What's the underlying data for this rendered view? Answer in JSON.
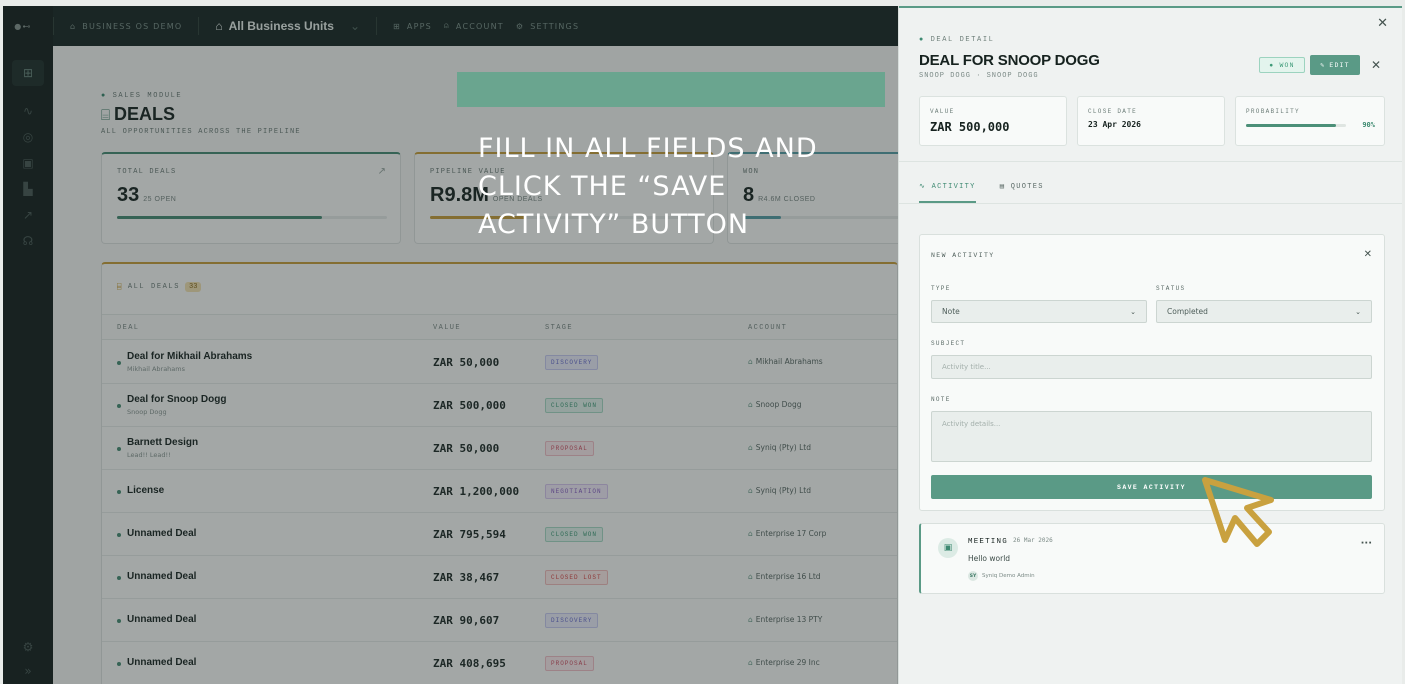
{
  "topbar": {
    "logo": "●⊷",
    "workspace": "BUSINESS OS DEMO",
    "business_unit": "All Business Units",
    "nav": [
      "APPS",
      "ACCOUNT",
      "SETTINGS"
    ]
  },
  "module": {
    "tag": "SALES MODULE",
    "title": "DEALS",
    "subtitle": "ALL OPPORTUNITIES ACROSS THE PIPELINE"
  },
  "stats": {
    "total": {
      "label": "TOTAL DEALS",
      "value": "33",
      "note": "25 OPEN",
      "progress": 0.76
    },
    "pipeline": {
      "label": "PIPELINE VALUE",
      "value": "R9.8M",
      "note": "OPEN DEALS",
      "progress": 0.35
    },
    "won": {
      "label": "WON",
      "value": "8",
      "note": "R4.6M CLOSED",
      "progress": 0.24
    }
  },
  "table": {
    "title": "ALL DEALS",
    "count": "33",
    "columns": [
      "DEAL",
      "VALUE",
      "STAGE",
      "ACCOUNT"
    ],
    "rows": [
      {
        "name": "Deal for Mikhail Abrahams",
        "sub": "Mikhail Abrahams",
        "value": "ZAR 50,000",
        "stage": "DISCOVERY",
        "account": "Mikhail Abrahams"
      },
      {
        "name": "Deal for Snoop Dogg",
        "sub": "Snoop Dogg",
        "value": "ZAR 500,000",
        "stage": "CLOSED WON",
        "account": "Snoop Dogg"
      },
      {
        "name": "Barnett Design",
        "sub": "Lead!! Lead!!",
        "value": "ZAR 50,000",
        "stage": "PROPOSAL",
        "account": "Syniq (Pty) Ltd"
      },
      {
        "name": "License",
        "sub": "",
        "value": "ZAR 1,200,000",
        "stage": "NEGOTIATION",
        "account": "Syniq (Pty) Ltd"
      },
      {
        "name": "Unnamed Deal",
        "sub": "",
        "value": "ZAR 795,594",
        "stage": "CLOSED WON",
        "account": "Enterprise 17 Corp"
      },
      {
        "name": "Unnamed Deal",
        "sub": "",
        "value": "ZAR 38,467",
        "stage": "CLOSED LOST",
        "account": "Enterprise 16 Ltd"
      },
      {
        "name": "Unnamed Deal",
        "sub": "",
        "value": "ZAR 90,607",
        "stage": "DISCOVERY",
        "account": "Enterprise 13 PTY"
      },
      {
        "name": "Unnamed Deal",
        "sub": "",
        "value": "ZAR 408,695",
        "stage": "PROPOSAL",
        "account": "Enterprise 29 Inc"
      }
    ]
  },
  "stage_colors": {
    "DISCOVERY": {
      "fg": "#6b6fd0",
      "bg": "#eceefc",
      "border": "#c9ccf2"
    },
    "CLOSED WON": {
      "fg": "#3d9a78",
      "bg": "#e3f4ed",
      "border": "#a9dac7"
    },
    "PROPOSAL": {
      "fg": "#d0566a",
      "bg": "#fcecef",
      "border": "#f1c0c9"
    },
    "NEGOTIATION": {
      "fg": "#8a62c4",
      "bg": "#f2ecfb",
      "border": "#d7c7ef"
    },
    "CLOSED LOST": {
      "fg": "#d84a4a",
      "bg": "#fdeceb",
      "border": "#f1bdbd"
    }
  },
  "instruction": {
    "text": "FILL IN ALL FIELDS AND CLICK THE “SAVE ACTIVITY” BUTTON"
  },
  "panel": {
    "tag": "DEAL DETAIL",
    "title": "DEAL FOR SNOOP DOGG",
    "subtitle": "SNOOP DOGG · SNOOP DOGG",
    "status": "WON",
    "edit_label": "EDIT",
    "value_label": "VALUE",
    "value": "ZAR 500,000",
    "close_label": "CLOSE DATE",
    "close_date": "23 Apr 2026",
    "prob_label": "PROBABILITY",
    "probability": "90%",
    "probability_fraction": 0.9,
    "tabs": [
      "ACTIVITY",
      "QUOTES"
    ],
    "new_activity": {
      "title": "NEW ACTIVITY",
      "type_label": "TYPE",
      "type_value": "Note",
      "status_label": "STATUS",
      "status_value": "Completed",
      "subject_label": "SUBJECT",
      "subject_placeholder": "Activity title...",
      "note_label": "NOTE",
      "note_placeholder": "Activity details...",
      "save_label": "SAVE ACTIVITY"
    },
    "activity": {
      "type": "MEETING",
      "date": "26 Mar 2026",
      "body": "Hello world",
      "user_initials": "SY",
      "user": "Syniq Demo Admin",
      "more": "···"
    }
  },
  "colors": {
    "accent": "#5a9a86",
    "instruction_band": "#6aa58f",
    "cursor": "#c9a13f",
    "sidebar": "#1e2d2a"
  }
}
